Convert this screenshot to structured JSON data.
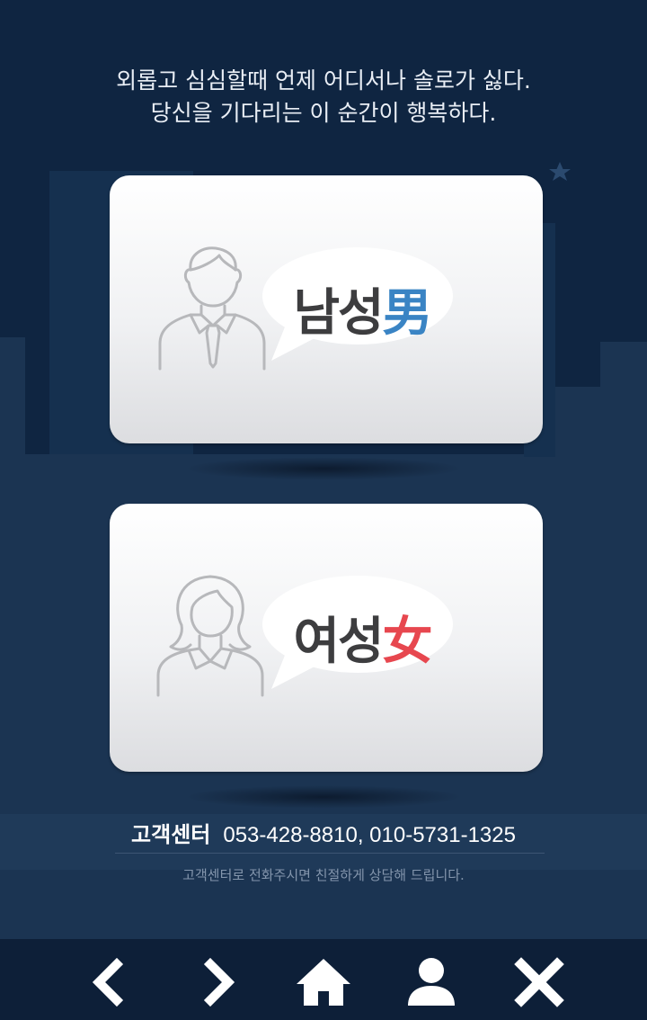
{
  "tagline": {
    "line1": "외롭고 심심할때 언제 어디서나 솔로가 싫다.",
    "line2": "당신을 기다리는 이 순간이 행복하다."
  },
  "cards": {
    "male": {
      "label": "남성",
      "hanja": "男",
      "icon": "male-person-icon"
    },
    "female": {
      "label": "여성",
      "hanja": "女",
      "icon": "female-person-icon"
    }
  },
  "contact": {
    "label": "고객센터",
    "phones": "053-428-8810, 010-5731-1325",
    "note": "고객센터로 전화주시면 친절하게 상담해 드립니다."
  },
  "nav": {
    "back": "chevron-left-icon",
    "forward": "chevron-right-icon",
    "home": "home-icon",
    "profile": "user-icon",
    "close": "close-icon"
  },
  "colors": {
    "background": "#0f2541",
    "male_accent": "#3a84c4",
    "female_accent": "#e7474f"
  }
}
